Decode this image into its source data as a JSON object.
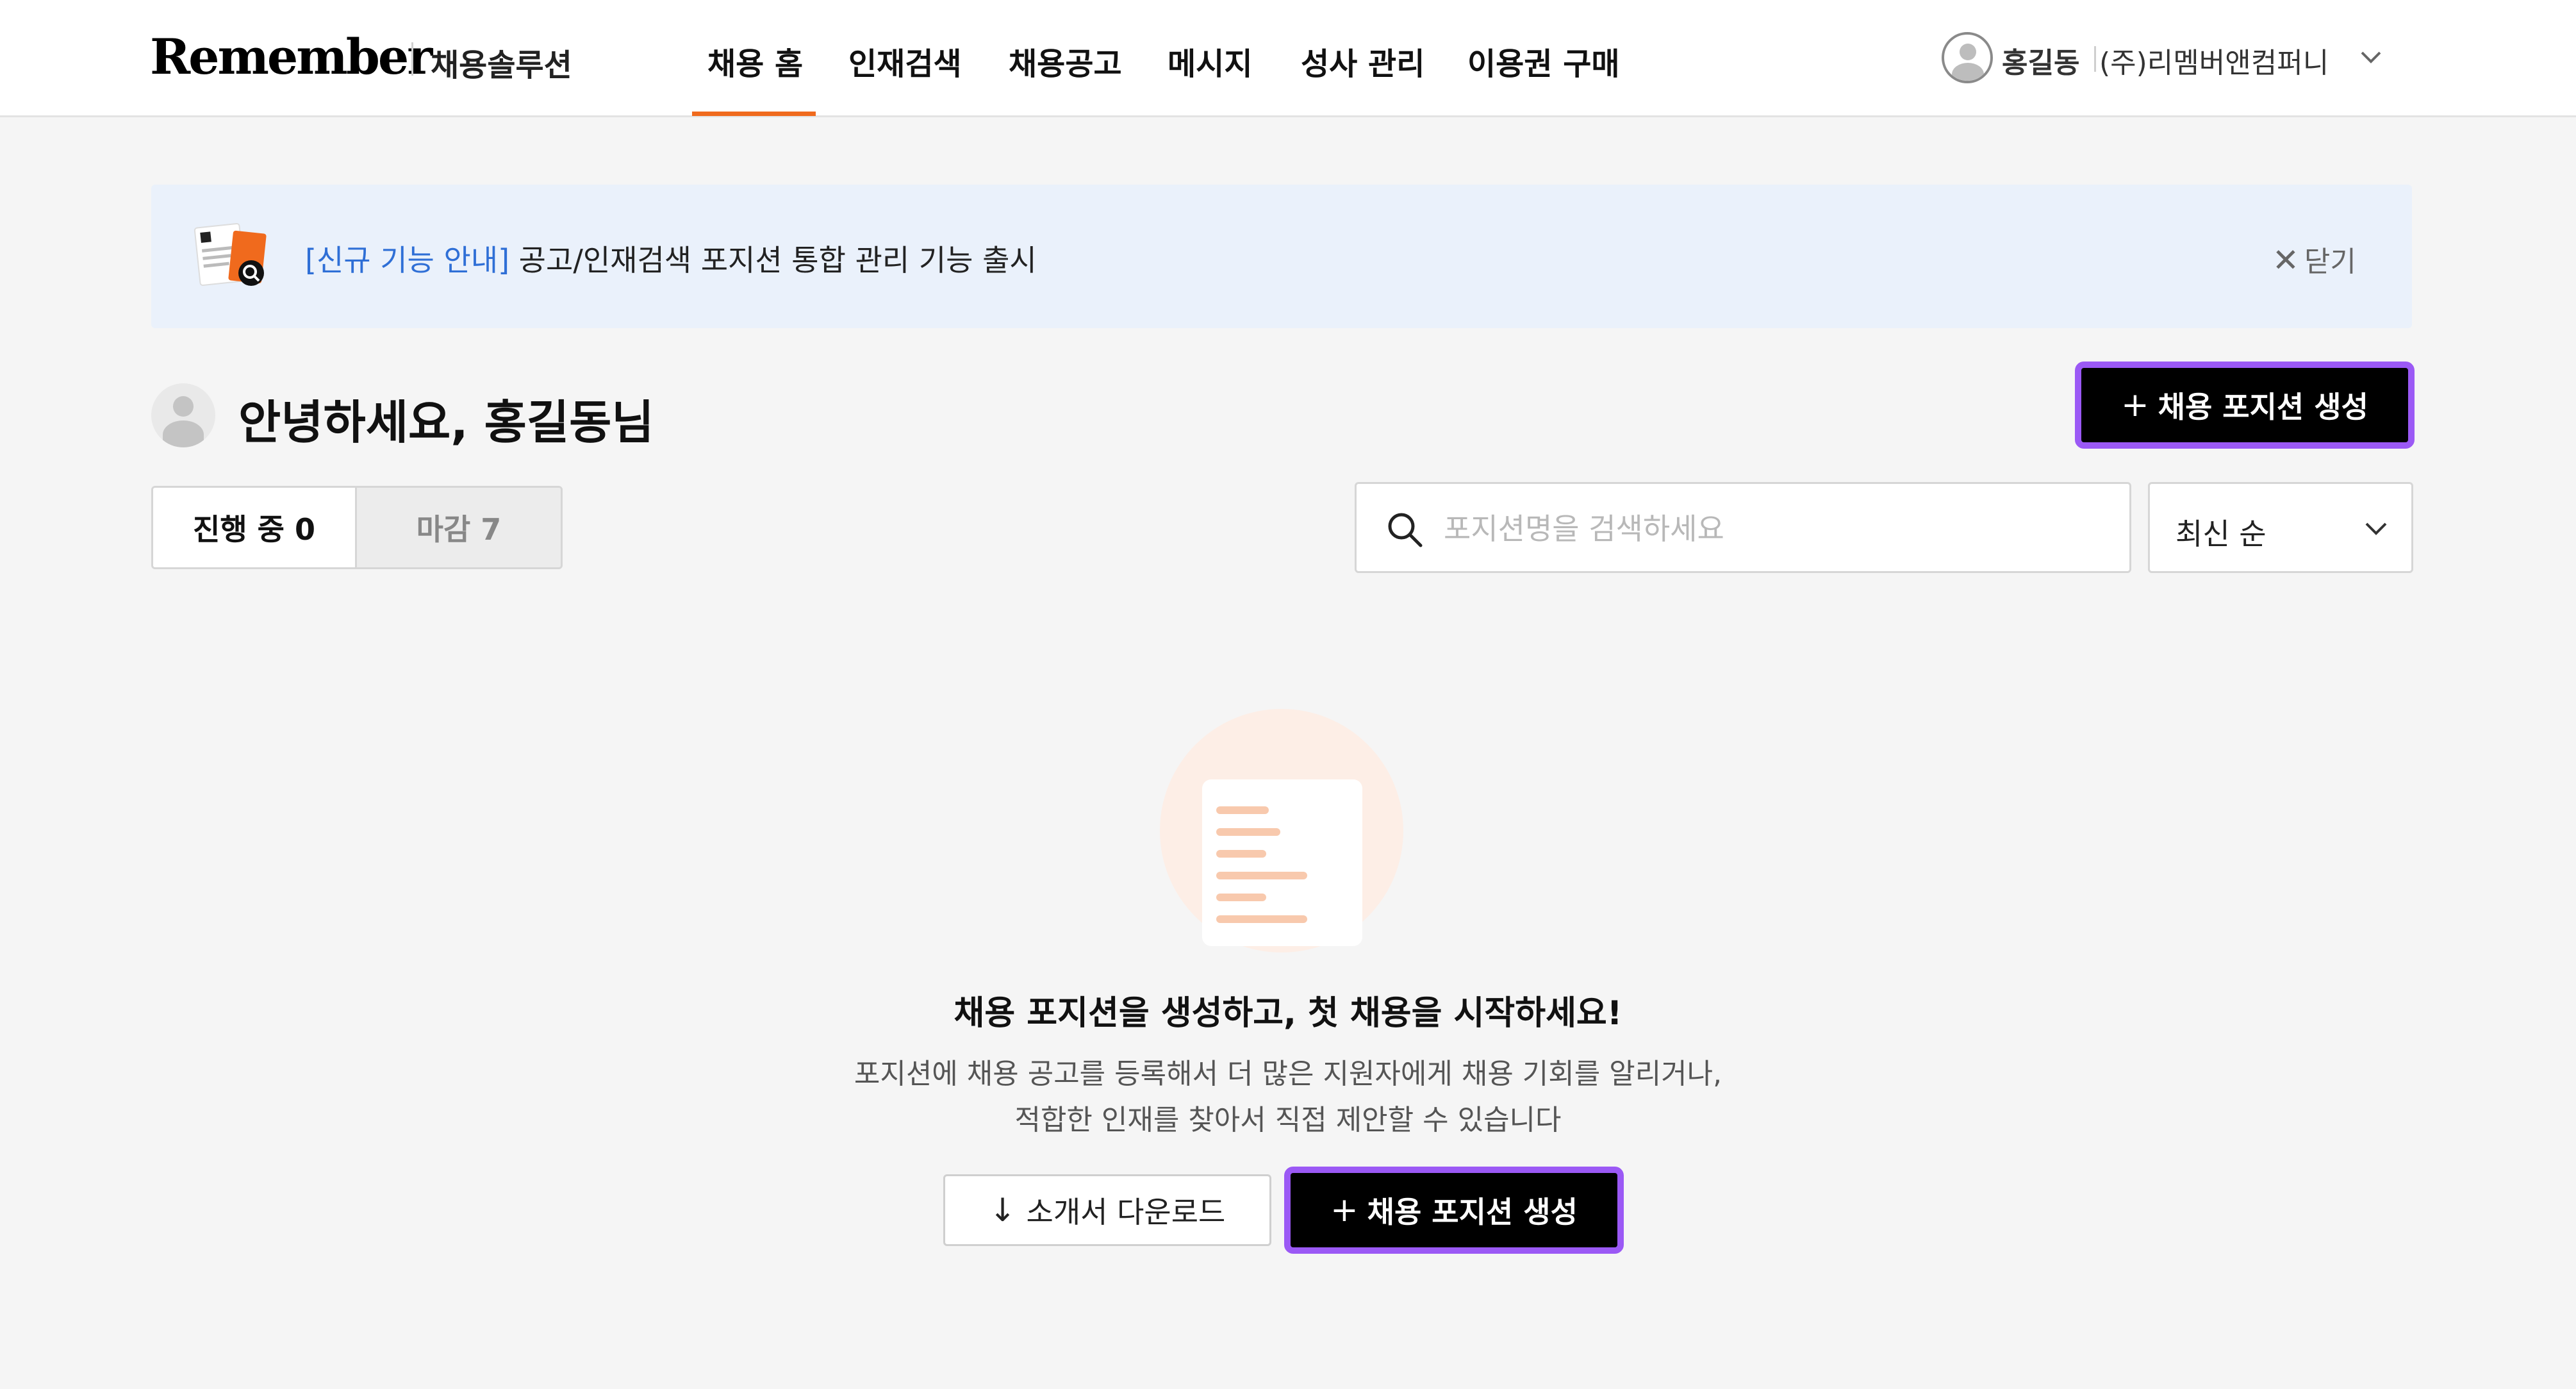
{
  "header": {
    "logo": "Remember",
    "logo_sub": "채용솔루션",
    "nav": [
      {
        "label": "채용 홈",
        "active": true
      },
      {
        "label": "인재검색"
      },
      {
        "label": "채용공고"
      },
      {
        "label": "메시지"
      },
      {
        "label": "성사 관리"
      },
      {
        "label": "이용권 구매"
      }
    ],
    "user_name": "홍길동",
    "company": "(주)리멤버앤컴퍼니",
    "user_icon": "user-avatar-icon",
    "menu_icon": "chevron-down-icon"
  },
  "banner": {
    "tag": "[신규 기능 안내]",
    "message": " 공고/인재검색 포지션 통합 관리 기능 출시",
    "close_label": "닫기"
  },
  "greeting": "안녕하세요, 홍길동님",
  "create_position_label": "채용 포지션 생성",
  "tabs": [
    {
      "label": "진행 중 0",
      "active": true
    },
    {
      "label": "마감 7",
      "active": false
    }
  ],
  "search": {
    "placeholder": "포지션명을 검색하세요",
    "value": ""
  },
  "sort": {
    "selected": "최신 순"
  },
  "empty_state": {
    "title": "채용 포지션을 생성하고, 첫 채용을 시작하세요!",
    "desc_line1": "포지션에 채용 공고를 등록해서 더 많은 지원자에게 채용 기회를 알리거나,",
    "desc_line2": "적합한 인재를 찾아서 직접 제안할 수 있습니다",
    "download_label": "소개서 다운로드",
    "create_label": "채용 포지션 생성"
  },
  "colors": {
    "accent": "#f06a1d",
    "highlight_border": "#9b59f5",
    "link_blue": "#2f6fd6",
    "banner_bg": "#eaf1fb",
    "page_bg": "#f5f5f5"
  }
}
